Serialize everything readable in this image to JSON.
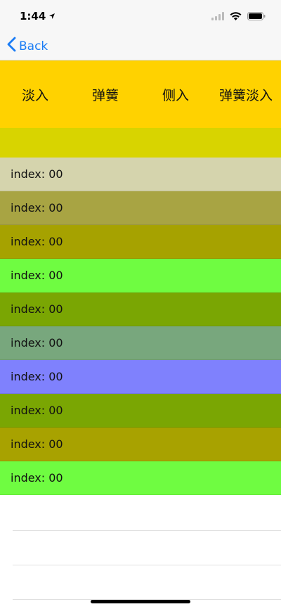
{
  "status": {
    "time": "1:44"
  },
  "nav": {
    "back_label": "Back",
    "accent": "#1a7cf5"
  },
  "tabs": [
    "淡入",
    "弹簧",
    "侧入",
    "弹簧淡入"
  ],
  "colors": {
    "tab_bar_bg": "#ffd200",
    "header_strip_bg": "#d8d400"
  },
  "rows": [
    {
      "label": "index: 00",
      "color": "#d5d4ad"
    },
    {
      "label": "index: 00",
      "color": "#a8a443"
    },
    {
      "label": "index: 00",
      "color": "#a6a200"
    },
    {
      "label": "index: 00",
      "color": "#6ffc41"
    },
    {
      "label": "index: 00",
      "color": "#7aa603"
    },
    {
      "label": "index: 00",
      "color": "#78a77d"
    },
    {
      "label": "index: 00",
      "color": "#7f81fd"
    },
    {
      "label": "index: 00",
      "color": "#7aa603"
    },
    {
      "label": "index: 00",
      "color": "#a8a200"
    },
    {
      "label": "index: 00",
      "color": "#6ffc41"
    }
  ]
}
